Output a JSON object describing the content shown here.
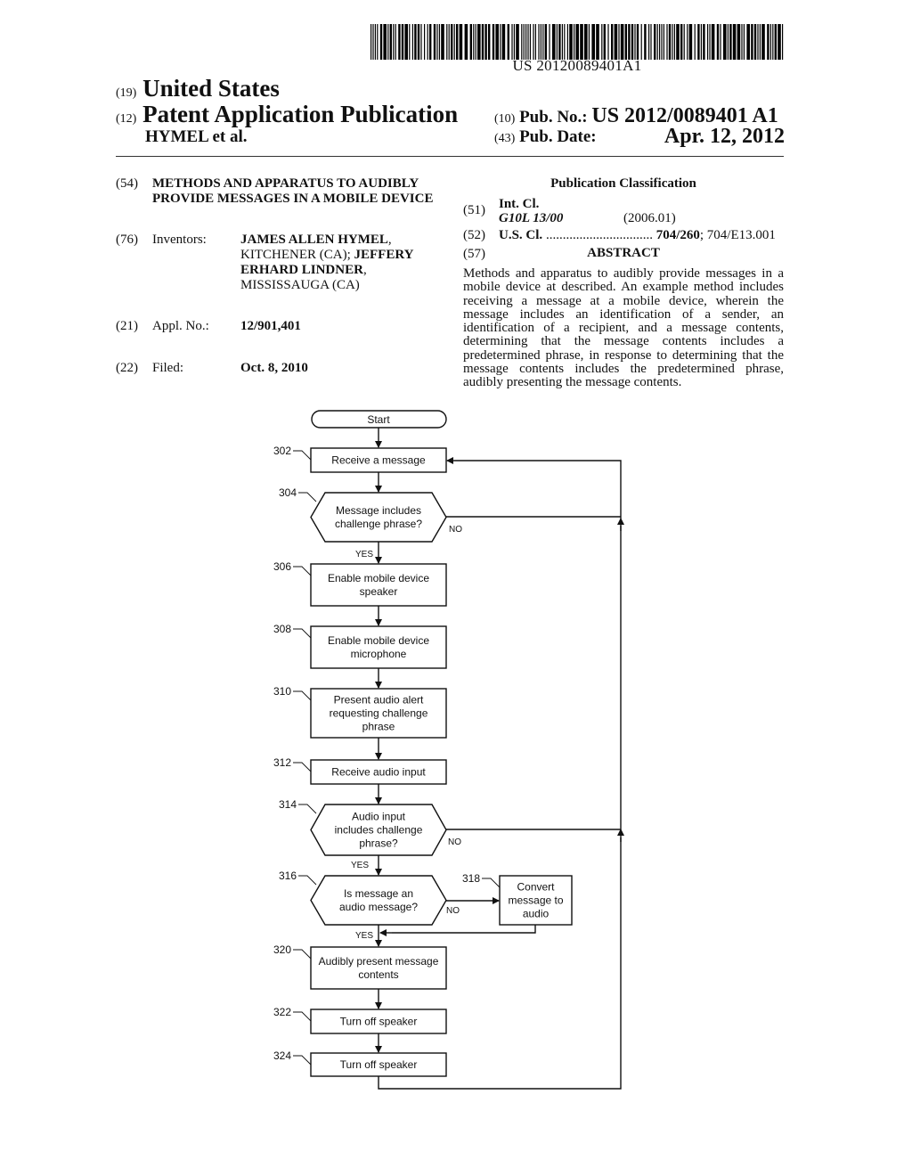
{
  "barcode": {
    "text": "US 20120089401A1"
  },
  "header": {
    "country_num": "(19)",
    "country": "United States",
    "type_num": "(12)",
    "type": "Patent Application Publication",
    "authors": "HYMEL et al.",
    "pub_no_num": "(10)",
    "pub_no_label": "Pub. No.:",
    "pub_no": "US 2012/0089401 A1",
    "pub_date_num": "(43)",
    "pub_date_label": "Pub. Date:",
    "pub_date": "Apr. 12, 2012"
  },
  "biblio": {
    "title_num": "(54)",
    "title_line1": "METHODS AND APPARATUS TO AUDIBLY",
    "title_line2": "PROVIDE MESSAGES IN A MOBILE DEVICE",
    "inventors_num": "(76)",
    "inventors_label": "Inventors:",
    "inventor1_name": "JAMES ALLEN HYMEL",
    "inventor1_loc": "KITCHENER (CA);",
    "inventor2_name_a": "JEFFERY",
    "inventor2_name_b": "ERHARD LINDNER",
    "inventor2_loc": "MISSISSAUGA (CA)",
    "appl_num": "(21)",
    "appl_label": "Appl. No.:",
    "appl_value": "12/901,401",
    "filed_num": "(22)",
    "filed_label": "Filed:",
    "filed_value": "Oct. 8, 2010"
  },
  "classification": {
    "heading": "Publication Classification",
    "int_num": "(51)",
    "int_label": "Int. Cl.",
    "int_code": "G10L 13/00",
    "int_version": "(2006.01)",
    "us_num": "(52)",
    "us_label": "U.S. Cl.",
    "us_dots": "................................",
    "us_primary": "704/260",
    "us_secondary": "; 704/E13.001"
  },
  "abstract": {
    "num": "(57)",
    "heading": "ABSTRACT",
    "text": "Methods and apparatus to audibly provide messages in a mobile device at described. An example method includes receiving a message at a mobile device, wherein the message includes an identification of a sender, an identification of a recipient, and a message contents, determining that the message contents includes a predetermined phrase, in response to determining that the message contents includes the predetermined phrase, audibly presenting the message contents."
  },
  "flowchart": {
    "start": "Start",
    "steps": {
      "s302": {
        "ref": "302",
        "lines": [
          "Receive a message"
        ]
      },
      "s304": {
        "ref": "304",
        "lines": [
          "Message includes",
          "challenge phrase?"
        ]
      },
      "s306": {
        "ref": "306",
        "lines": [
          "Enable mobile device",
          "speaker"
        ]
      },
      "s308": {
        "ref": "308",
        "lines": [
          "Enable mobile device",
          "microphone"
        ]
      },
      "s310": {
        "ref": "310",
        "lines": [
          "Present audio alert",
          "requesting challenge",
          "phrase"
        ]
      },
      "s312": {
        "ref": "312",
        "lines": [
          "Receive audio input"
        ]
      },
      "s314": {
        "ref": "314",
        "lines": [
          "Audio input",
          "includes challenge",
          "phrase?"
        ]
      },
      "s316": {
        "ref": "316",
        "lines": [
          "Is message an",
          "audio message?"
        ]
      },
      "s318": {
        "ref": "318",
        "lines": [
          "Convert",
          "message to",
          "audio"
        ]
      },
      "s320": {
        "ref": "320",
        "lines": [
          "Audibly present message",
          "contents"
        ]
      },
      "s322": {
        "ref": "322",
        "lines": [
          "Turn off speaker"
        ]
      },
      "s324": {
        "ref": "324",
        "lines": [
          "Turn off speaker"
        ]
      }
    },
    "yes": "YES",
    "no": "NO"
  }
}
